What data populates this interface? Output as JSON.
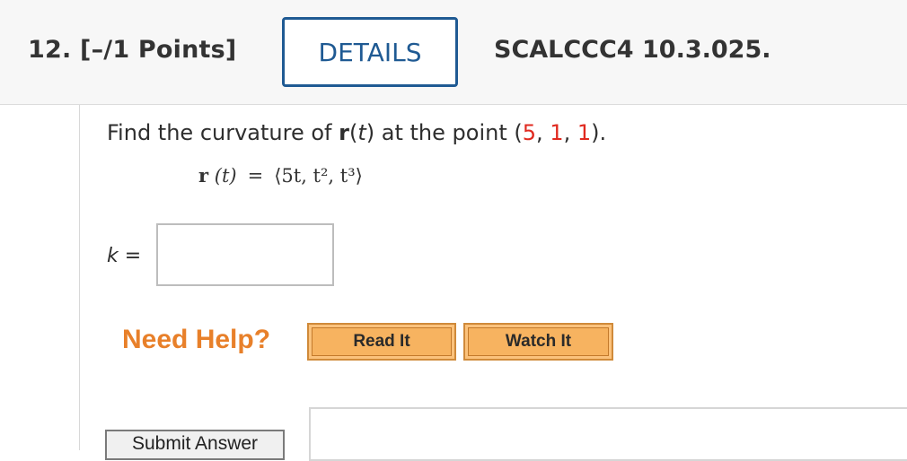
{
  "header": {
    "question_label": "12.  [–/1 Points]",
    "details_button": "DETAILS",
    "reference_code": "SCALCCC4 10.3.025."
  },
  "question": {
    "prompt_prefix": "Find the curvature of ",
    "vector_symbol": "r",
    "paren_open": "(",
    "param": "t",
    "paren_close": ")",
    "prompt_mid": " at the point (",
    "point_x": "5",
    "sep1": ", ",
    "point_y": "1",
    "sep2": ", ",
    "point_z": "1",
    "prompt_suffix": ").",
    "equation": {
      "lhs_symbol": "r",
      "lhs_arg": "(t)",
      "equals": "=",
      "rhs": "⟨5t, t², t³⟩"
    }
  },
  "answer": {
    "label_var": "k",
    "label_equals": " =",
    "value": ""
  },
  "help": {
    "title": "Need Help?",
    "read_button": "Read It",
    "watch_button": "Watch It"
  },
  "actions": {
    "submit_button": "Submit Answer"
  }
}
